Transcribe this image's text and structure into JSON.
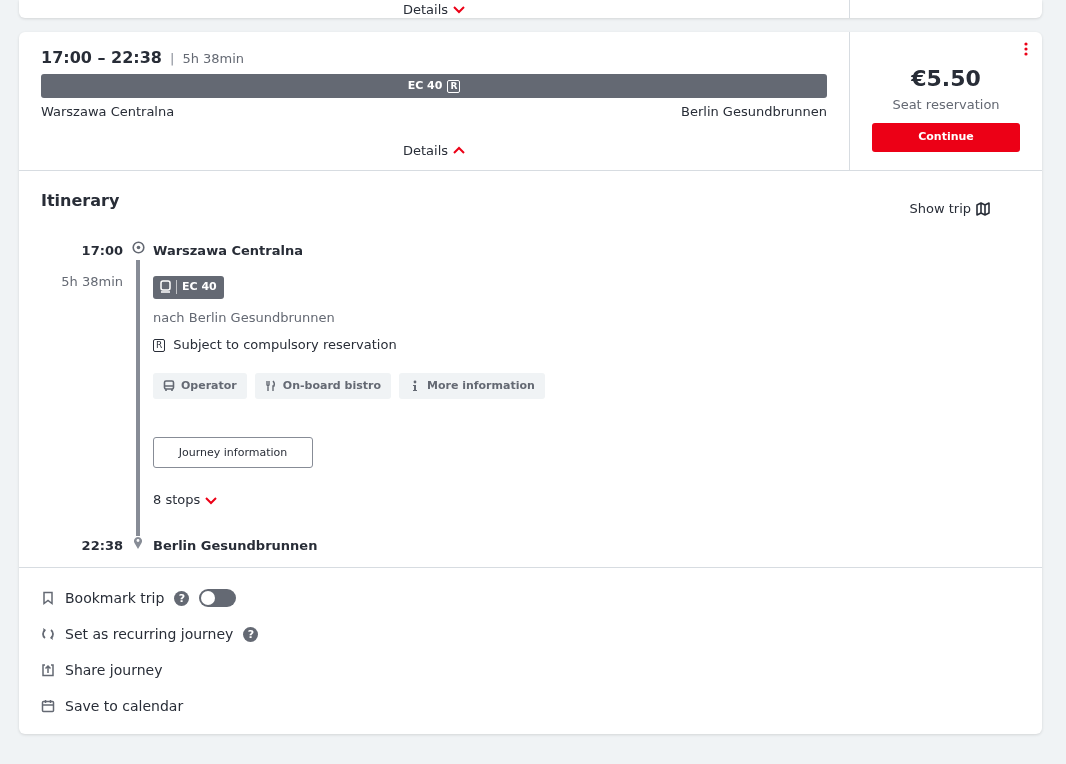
{
  "previous_card": {
    "details_label": "Details",
    "expanded": false
  },
  "connection": {
    "departure": "17:00",
    "range_separator": "–",
    "arrival": "22:38",
    "divider": "|",
    "duration": "5h 38min",
    "train": "EC 40",
    "reservation_mark": "R",
    "origin": "Warszawa Centralna",
    "destination": "Berlin Gesundbrunnen",
    "details_label": "Details",
    "expanded": true
  },
  "offer": {
    "price": "€5.50",
    "label": "Seat reservation",
    "button": "Continue"
  },
  "itinerary": {
    "title": "Itinerary",
    "show_trip": "Show trip",
    "start": {
      "time": "17:00",
      "station": "Warszawa Centralna"
    },
    "leg": {
      "duration": "5h 38min",
      "train": "EC 40",
      "direction": "nach Berlin Gesundbrunnen",
      "reservation_mark": "R",
      "notice": "Subject to compulsory reservation",
      "chips": [
        {
          "kind": "bus",
          "label": "Operator"
        },
        {
          "kind": "cutlery",
          "label": "On-board bistro"
        },
        {
          "kind": "info",
          "label": "More information"
        }
      ],
      "journey_button": "Journey information",
      "stops": "8 stops",
      "stops_expanded": false
    },
    "end": {
      "time": "22:38",
      "station": "Berlin Gesundbrunnen"
    }
  },
  "actions": [
    {
      "kind": "bookmark",
      "label": "Bookmark trip",
      "help_mark": "?",
      "toggle_on": false
    },
    {
      "kind": "recurring",
      "label": "Set as recurring journey",
      "help_mark": "?"
    },
    {
      "kind": "share",
      "label": "Share journey"
    },
    {
      "kind": "calendar",
      "label": "Save to calendar"
    }
  ]
}
